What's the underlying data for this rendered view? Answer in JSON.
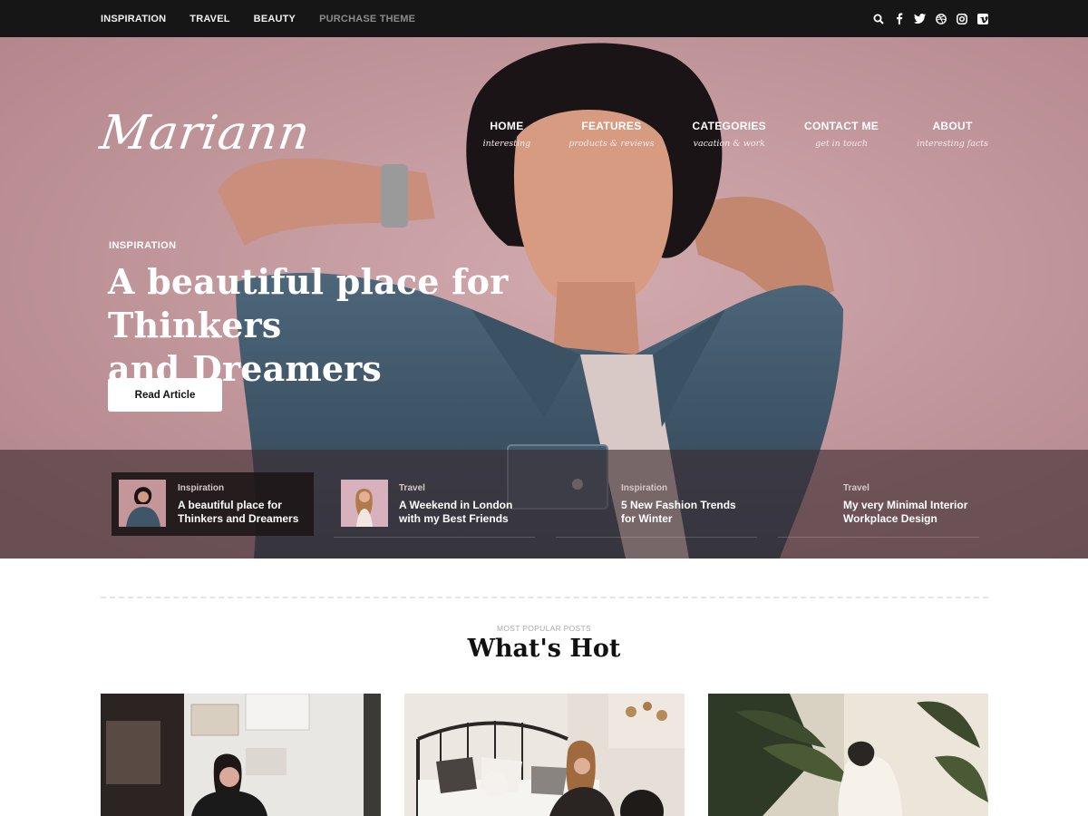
{
  "topbar": {
    "links": [
      "INSPIRATION",
      "TRAVEL",
      "BEAUTY"
    ],
    "purchase": "PURCHASE THEME",
    "icons": [
      "search-icon",
      "facebook-icon",
      "twitter-icon",
      "dribbble-icon",
      "instagram-icon",
      "vimeo-icon"
    ]
  },
  "site": {
    "logo": "Mariann"
  },
  "mainnav": [
    {
      "label": "HOME",
      "sub": "interesting"
    },
    {
      "label": "FEATURES",
      "sub": "products & reviews"
    },
    {
      "label": "CATEGORIES",
      "sub": "vacation & work"
    },
    {
      "label": "CONTACT ME",
      "sub": "get in touch"
    },
    {
      "label": "ABOUT",
      "sub": "interesting facts"
    }
  ],
  "hero": {
    "category": "INSPIRATION",
    "title_line1": "A beautiful place for Thinkers",
    "title_line2": "and Dreamers",
    "button": "Read Article"
  },
  "slides": [
    {
      "category": "Inspiration",
      "title_line1": "A beautiful place for",
      "title_line2": "Thinkers and Dreamers"
    },
    {
      "category": "Travel",
      "title_line1": "A Weekend in London",
      "title_line2": "with my Best Friends"
    },
    {
      "category": "Inspiration",
      "title_line1": "5 New Fashion Trends",
      "title_line2": "for Winter"
    },
    {
      "category": "Travel",
      "title_line1": "My very Minimal Interior",
      "title_line2": "Workplace Design"
    }
  ],
  "section": {
    "kicker": "MOST POPULAR POSTS",
    "title": "What's Hot"
  },
  "colors": {
    "topbar": "#161616",
    "hero_pink": "#c39599",
    "denim": "#3f5668",
    "strip": "#3c2c30"
  }
}
